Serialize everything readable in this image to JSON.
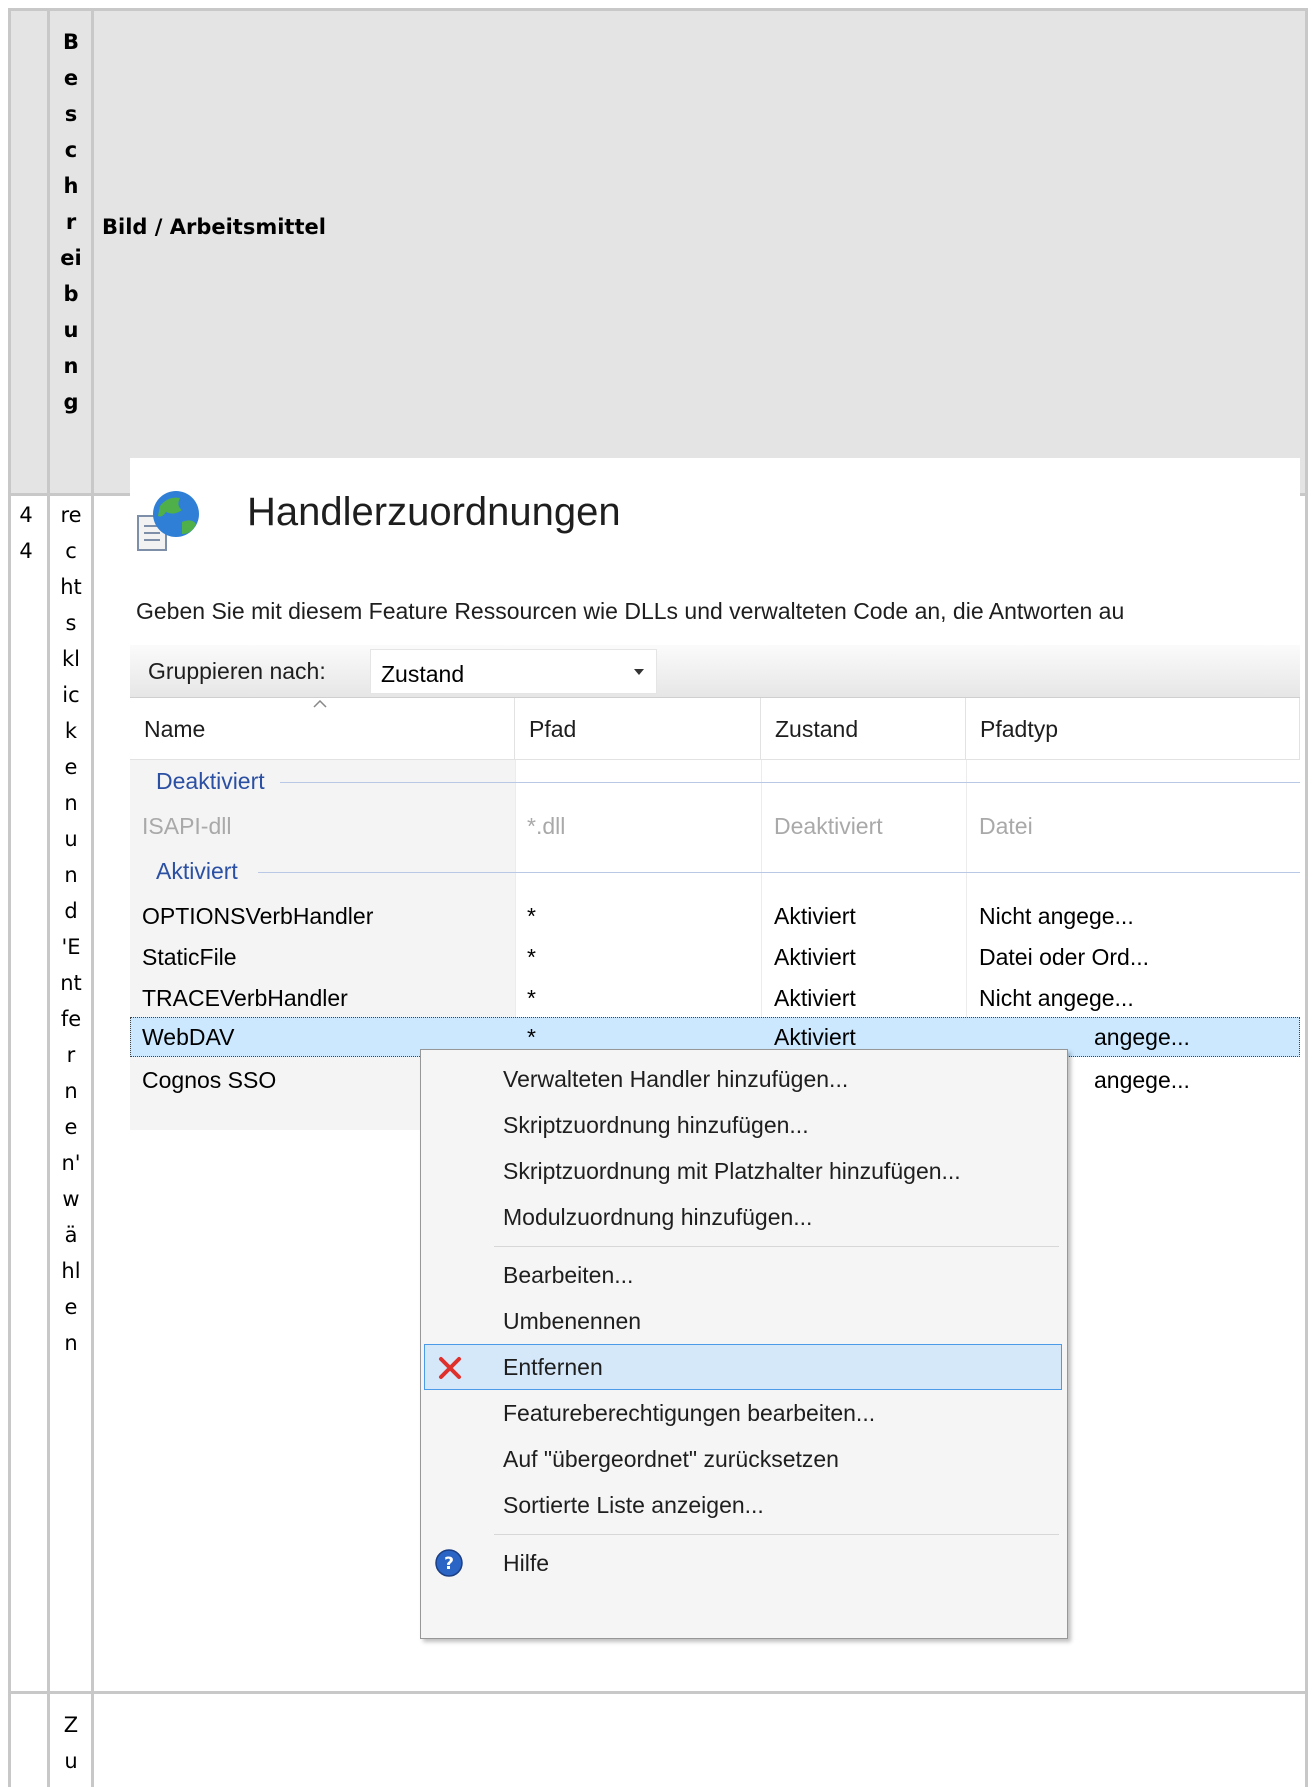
{
  "wiki_table": {
    "header": {
      "col2_vertical": [
        "B",
        "e",
        "s",
        "c",
        "h",
        "r",
        "ei",
        "b",
        "u",
        "n",
        "g"
      ],
      "col3": "Bild / Arbeitsmittel"
    },
    "row": {
      "col1_vertical": [
        "4",
        "4"
      ],
      "col2_vertical": [
        "re",
        "c",
        "ht",
        "s",
        "kl",
        "ic",
        "k",
        "e",
        "n",
        "u",
        "n",
        "d",
        "'E",
        "nt",
        "fe",
        "r",
        "n",
        "e",
        "n'",
        "w",
        "ä",
        "hl",
        "e",
        "n"
      ]
    },
    "next_row": {
      "col2_vertical": [
        "Z",
        "u"
      ]
    }
  },
  "iis": {
    "title": "Handlerzuordnungen",
    "description": "Geben Sie mit diesem Feature Ressourcen wie DLLs und verwalteten Code an, die Antworten au",
    "toolbar": {
      "group_label": "Gruppieren nach:",
      "group_value": "Zustand"
    },
    "columns": [
      "Name",
      "Pfad",
      "Zustand",
      "Pfadtyp"
    ],
    "groups": [
      {
        "label": "Deaktiviert",
        "rows": [
          {
            "name": "ISAPI-dll",
            "path": "*.dll",
            "state": "Deaktiviert",
            "type": "Datei"
          }
        ]
      },
      {
        "label": "Aktiviert",
        "rows": [
          {
            "name": "OPTIONSVerbHandler",
            "path": "*",
            "state": "Aktiviert",
            "type": "Nicht angege..."
          },
          {
            "name": "StaticFile",
            "path": "*",
            "state": "Aktiviert",
            "type": "Datei oder Ord..."
          },
          {
            "name": "TRACEVerbHandler",
            "path": "*",
            "state": "Aktiviert",
            "type": "Nicht angege..."
          },
          {
            "name": "WebDAV",
            "path": "*",
            "state": "Aktiviert",
            "type": "angege..."
          },
          {
            "name": "Cognos SSO",
            "path": "",
            "state": "",
            "type": "angege..."
          }
        ]
      }
    ]
  },
  "context_menu": {
    "items": [
      "Verwalteten Handler hinzufügen...",
      "Skriptzuordnung hinzufügen...",
      "Skriptzuordnung mit Platzhalter hinzufügen...",
      "Modulzuordnung hinzufügen...",
      "Bearbeiten...",
      "Umbenennen",
      "Entfernen",
      "Featureberechtigungen bearbeiten...",
      "Auf \"übergeordnet\" zurücksetzen",
      "Sortierte Liste anzeigen...",
      "Hilfe"
    ],
    "highlighted": "Entfernen",
    "icons": {
      "remove": "red-x-icon",
      "help": "help-icon"
    }
  }
}
